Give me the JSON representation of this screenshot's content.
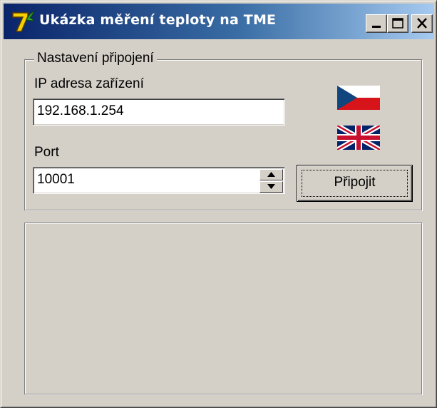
{
  "window": {
    "title": "Ukázka měření teploty na TME",
    "icon": "app-logo-icon"
  },
  "connection": {
    "group_title": "Nastavení připojení",
    "ip_label": "IP adresa zařízení",
    "ip_value": "192.168.1.254",
    "port_label": "Port",
    "port_value": "10001",
    "connect_label": "Připojit"
  },
  "languages": [
    {
      "name": "czech-flag-icon"
    },
    {
      "name": "uk-flag-icon"
    }
  ],
  "colors": {
    "face": "#d4d0c8",
    "title_start": "#0a246a",
    "title_end": "#a6caf0"
  }
}
